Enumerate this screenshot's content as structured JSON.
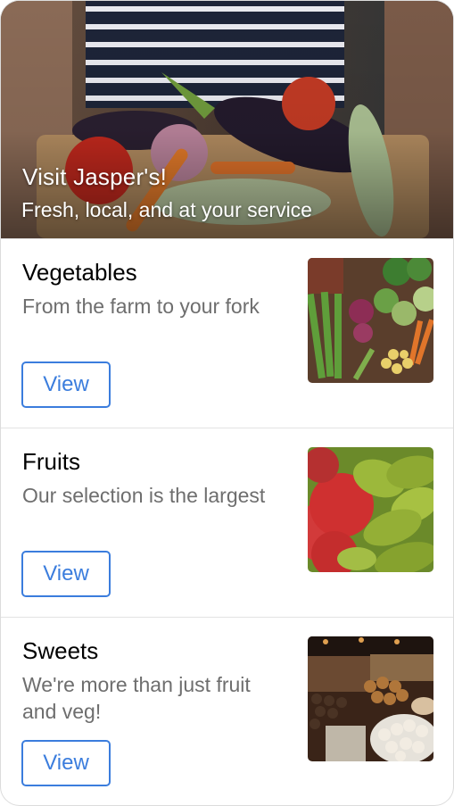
{
  "hero": {
    "title": "Visit Jasper's!",
    "subtitle": "Fresh, local, and at your service",
    "image_icon": "vegetables-basket-photo"
  },
  "items": [
    {
      "title": "Vegetables",
      "description": "From the farm to your fork",
      "button_label": "View",
      "image_icon": "vegetables-photo"
    },
    {
      "title": "Fruits",
      "description": "Our selection is the largest",
      "button_label": "View",
      "image_icon": "fruits-photo"
    },
    {
      "title": "Sweets",
      "description": "We're more than just fruit and veg!",
      "button_label": "View",
      "image_icon": "sweets-photo"
    }
  ],
  "colors": {
    "accent": "#3b7ddd",
    "text": "#000000",
    "muted": "#6e6e6e",
    "divider": "#e3e3e3"
  }
}
